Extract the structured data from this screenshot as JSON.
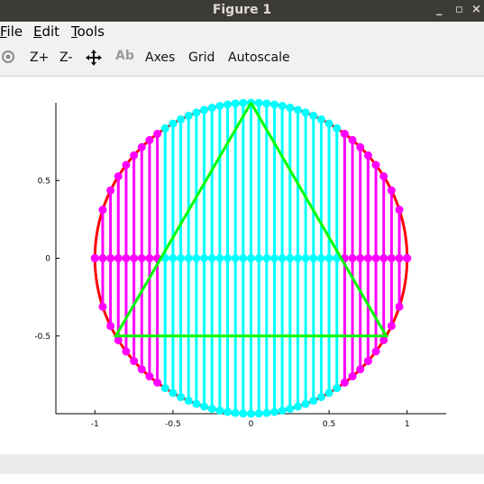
{
  "window": {
    "title": "Figure 1",
    "minimize_glyph": "_",
    "maximize_glyph": "▫",
    "close_glyph": "×"
  },
  "menu": [
    {
      "accel": "F",
      "rest": "ile"
    },
    {
      "accel": "E",
      "rest": "dit"
    },
    {
      "accel": "T",
      "rest": "ools"
    }
  ],
  "toolbar": {
    "rotate_icon": "rotate-icon",
    "zoom_in": "Z+",
    "zoom_out": "Z-",
    "pan_icon": "pan-move-icon",
    "text_tool": "Ab",
    "axes": "Axes",
    "grid": "Grid",
    "autoscale": "Autoscale"
  },
  "chart_data": {
    "type": "line",
    "title": "",
    "xlabel": "",
    "ylabel": "",
    "xlim": [
      -1.25,
      1.25
    ],
    "ylim": [
      -1.0,
      1.0
    ],
    "x_ticks": [
      -1,
      -0.5,
      0,
      0.5,
      1
    ],
    "x_tick_labels": [
      "-1",
      "-0.5",
      "0",
      "0.5",
      "1"
    ],
    "y_ticks": [
      -0.5,
      0,
      0.5
    ],
    "y_tick_labels": [
      "-0.5",
      "0",
      "0.5"
    ],
    "grid": false,
    "series": [
      {
        "kind": "circle",
        "color": "#ff0000",
        "center": [
          0,
          0
        ],
        "radius": 1
      },
      {
        "kind": "polygon",
        "color": "#00ff00",
        "points": [
          [
            0,
            1
          ],
          [
            -0.866,
            -0.5
          ],
          [
            0.866,
            -0.5
          ],
          [
            0,
            1
          ]
        ]
      },
      {
        "kind": "stems",
        "color": "#ff00ff",
        "x": [
          -1.0,
          -0.95,
          -0.9,
          -0.85,
          -0.8,
          -0.75,
          -0.7,
          -0.65,
          -0.6,
          0.6,
          0.65,
          0.7,
          0.75,
          0.8,
          0.85,
          0.9,
          0.95,
          1.0
        ]
      },
      {
        "kind": "stems",
        "color": "#00ffff",
        "x": [
          -0.55,
          -0.5,
          -0.45,
          -0.4,
          -0.35,
          -0.3,
          -0.25,
          -0.2,
          -0.15,
          -0.1,
          -0.05,
          0.0,
          0.05,
          0.1,
          0.15,
          0.2,
          0.25,
          0.3,
          0.35,
          0.4,
          0.45,
          0.5,
          0.55
        ]
      }
    ],
    "stem_markers": "circle markers at top, bottom and center (y=0) of each vertical stem"
  }
}
